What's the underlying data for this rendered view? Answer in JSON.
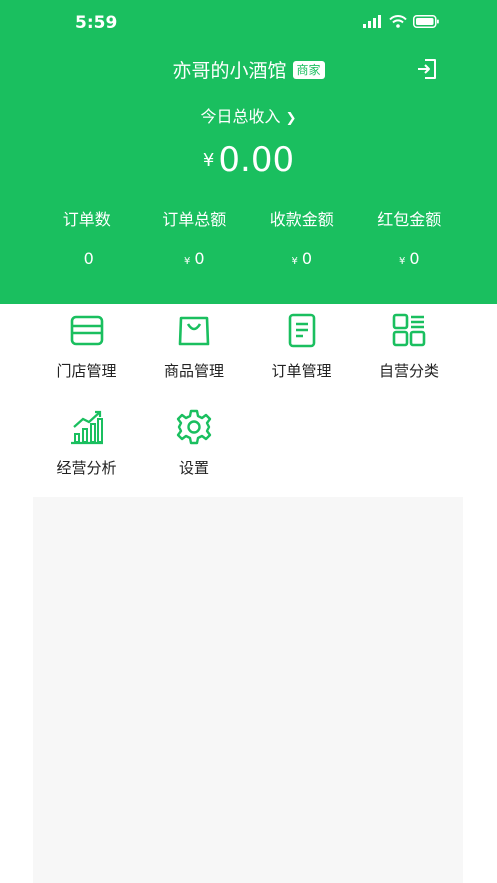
{
  "status_bar": {
    "time": "5:59"
  },
  "header": {
    "shop_name": "亦哥的小酒馆",
    "badge": "商家",
    "income_label": "今日总收入",
    "income_arrow": "❯",
    "currency": "¥",
    "income_value": "0.00"
  },
  "stats": [
    {
      "label": "订单数",
      "currency": "",
      "value": "0"
    },
    {
      "label": "订单总额",
      "currency": "¥",
      "value": "0"
    },
    {
      "label": "收款金额",
      "currency": "¥",
      "value": "0"
    },
    {
      "label": "红包金额",
      "currency": "¥",
      "value": "0"
    }
  ],
  "menu": [
    {
      "label": "门店管理",
      "icon": "store-icon"
    },
    {
      "label": "商品管理",
      "icon": "shopping-bag-icon"
    },
    {
      "label": "订单管理",
      "icon": "document-icon"
    },
    {
      "label": "自营分类",
      "icon": "category-grid-icon"
    },
    {
      "label": "经营分析",
      "icon": "bar-chart-icon"
    },
    {
      "label": "设置",
      "icon": "gear-icon"
    }
  ],
  "colors": {
    "primary": "#1abf5f",
    "panel": "#f7f7f7"
  }
}
